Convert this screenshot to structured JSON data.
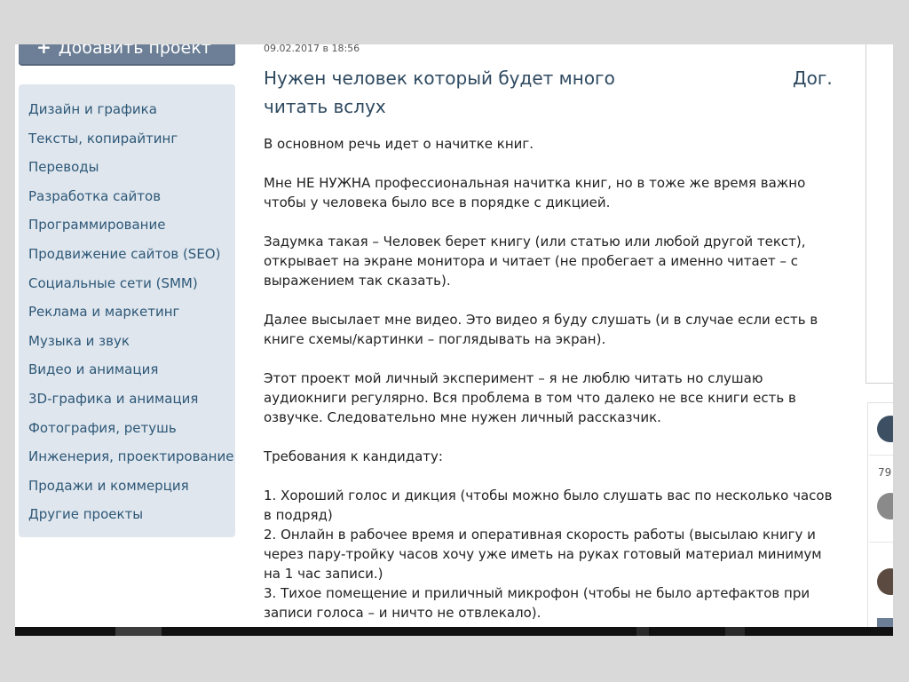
{
  "sidebar": {
    "add_button_label": "Добавить проект",
    "categories": [
      "Дизайн и графика",
      "Тексты, копирайтинг",
      "Переводы",
      "Разработка сайтов",
      "Программирование",
      "Продвижение сайтов (SEO)",
      "Социальные сети (SMM)",
      "Реклама и маркетинг",
      "Музыка и звук",
      "Видео и анимация",
      "3D-графика и анимация",
      "Фотография, ретушь",
      "Инженерия, проектирование",
      "Продажи и коммерция",
      "Другие проекты"
    ]
  },
  "project": {
    "date": "09.02.2017 в 18:56",
    "title": "Нужен человек который будет много читать вслух",
    "budget": "Дог.",
    "paragraphs": [
      "В основном речь идет о начитке книг.",
      "Мне НЕ НУЖНА профессиональная начитка книг, но в тоже же время важно чтобы у человека было все в порядке с дикцией.",
      "Задумка такая – Человек берет книгу (или статью или любой другой текст), открывает на экране монитора и читает (не пробегает а именно читает – с выражением так сказать).",
      "Далее высылает мне видео. Это видео я буду слушать (и в случае если есть в книге схемы/картинки – поглядывать на экран).",
      "Этот проект мой личный эксперимент – я не люблю читать но слушаю аудиокниги регулярно. Вся проблема в том что далеко не все книги есть в озвучке. Следовательно мне нужен личный рассказчик.",
      "Требования к кандидату:"
    ],
    "requirements": [
      "1. Хороший голос и дикция (чтобы можно было слушать вас по несколько часов в подряд)",
      "2. Онлайн в рабочее время и оперативная скорость работы (высылаю книгу и через пару-тройку часов хочу уже иметь на руках готовый материал минимум на 1 час записи.)",
      "3. Тихое помещение и приличный микрофон (чтобы не было артефактов при записи голоса – и ничто не отвлекало)."
    ]
  },
  "right_column": {
    "count_fragment": "79"
  },
  "icons": {
    "add": "plus-icon"
  }
}
